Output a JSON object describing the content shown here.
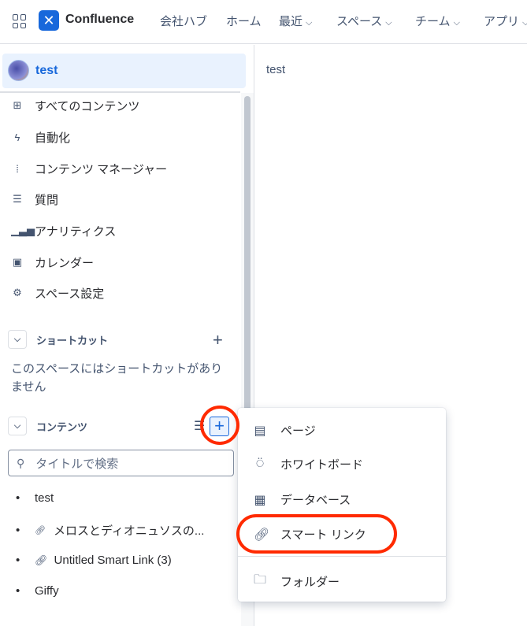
{
  "header": {
    "app_name": "Confluence",
    "nav": [
      {
        "label": "会社ハブ",
        "dropdown": false
      },
      {
        "label": "ホーム",
        "dropdown": false
      },
      {
        "label": "最近",
        "dropdown": true
      },
      {
        "label": "スペース",
        "dropdown": true
      },
      {
        "label": "チーム",
        "dropdown": true
      },
      {
        "label": "アプリ",
        "dropdown": true
      }
    ]
  },
  "sidebar": {
    "space_name": "test",
    "items": [
      {
        "label": "すべてのコンテンツ",
        "icon": "grid-icon"
      },
      {
        "label": "自動化",
        "icon": "lightning-icon"
      },
      {
        "label": "コンテンツ マネージャー",
        "icon": "content-manager-icon"
      },
      {
        "label": "質問",
        "icon": "question-icon"
      },
      {
        "label": "アナリティクス",
        "icon": "chart-icon"
      },
      {
        "label": "カレンダー",
        "icon": "calendar-icon"
      },
      {
        "label": "スペース設定",
        "icon": "gear-icon"
      }
    ],
    "shortcuts": {
      "title": "ショートカット",
      "empty": "このスペースにはショートカットがありません"
    },
    "content": {
      "title": "コンテンツ",
      "search_placeholder": "タイトルで検索",
      "items": [
        {
          "label": "test",
          "link": false
        },
        {
          "label": "メロスとディオニュソスの...",
          "link": true
        },
        {
          "label": "Untitled Smart Link (3)",
          "link": true
        },
        {
          "label": "Giffy",
          "link": false
        }
      ]
    }
  },
  "main": {
    "title": "test"
  },
  "menu": {
    "items": [
      {
        "label": "ページ",
        "icon": "page-icon"
      },
      {
        "label": "ホワイトボード",
        "icon": "whiteboard-icon"
      },
      {
        "label": "データベース",
        "icon": "database-icon"
      },
      {
        "label": "スマート リンク",
        "icon": "link-icon"
      },
      {
        "label": "フォルダー",
        "icon": "folder-icon"
      }
    ]
  },
  "colors": {
    "accent": "#1868db",
    "annotation": "#ff2a00"
  }
}
